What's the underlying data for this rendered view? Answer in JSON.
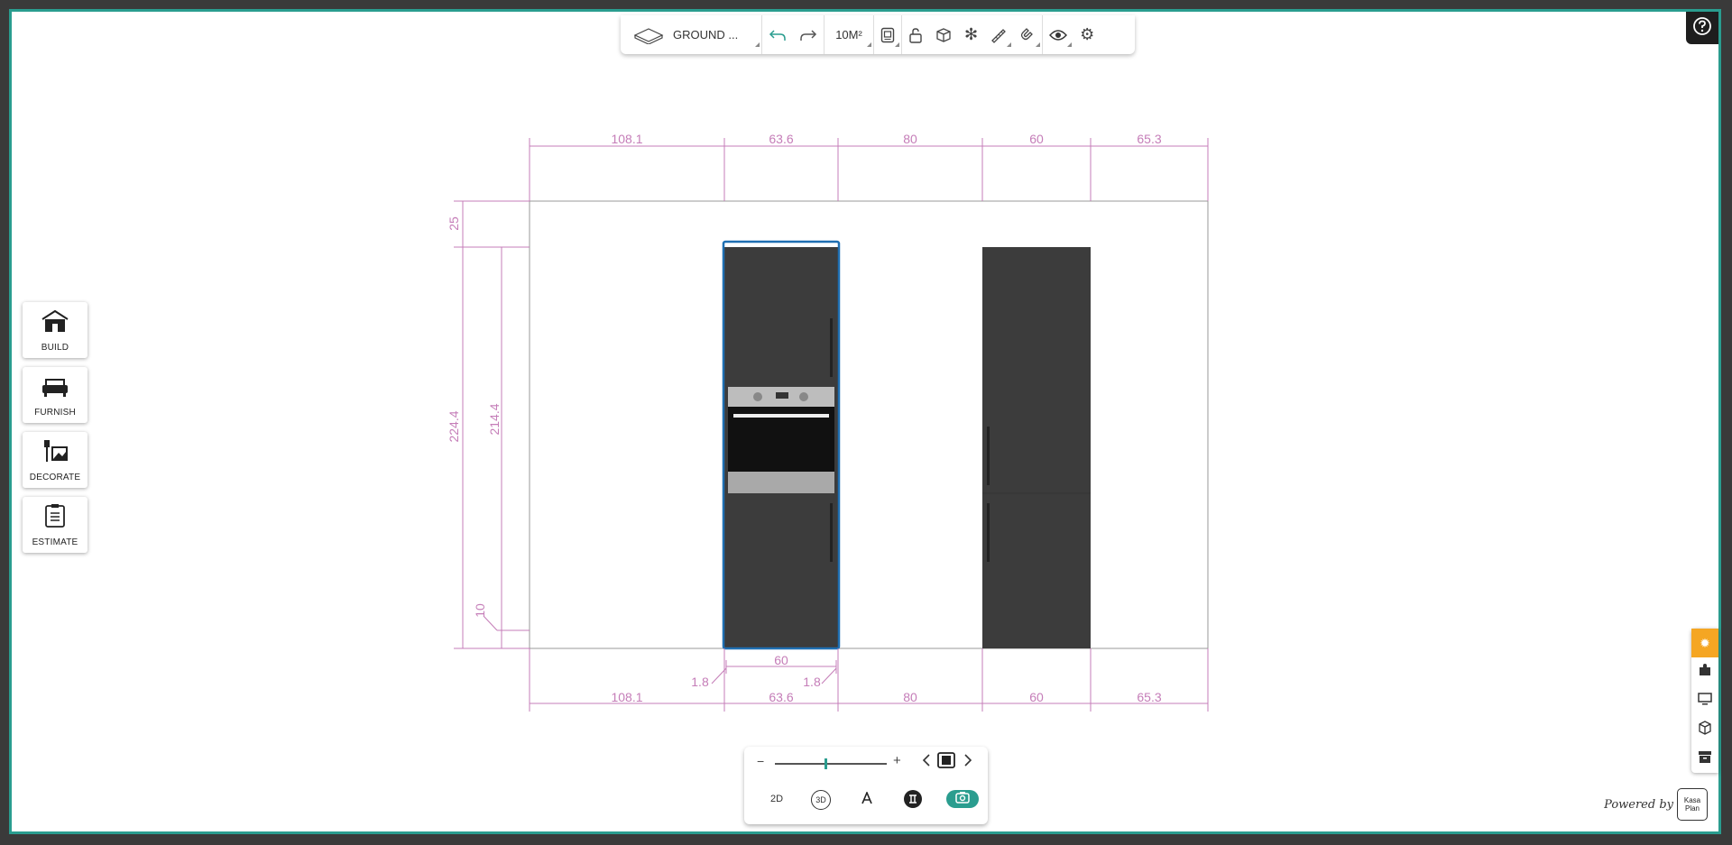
{
  "toolbar": {
    "floor_label": "GROUND ...",
    "area_label": "10M²"
  },
  "left_menu": [
    {
      "label": "BUILD",
      "icon": "house-icon"
    },
    {
      "label": "FURNISH",
      "icon": "sofa-icon"
    },
    {
      "label": "DECORATE",
      "icon": "paint-icon"
    },
    {
      "label": "ESTIMATE",
      "icon": "clipboard-icon"
    }
  ],
  "bottom": {
    "zoom_minus": "−",
    "zoom_plus": "+",
    "zoom_level": 0.45,
    "view_2d": "2D",
    "view_3d": "3D"
  },
  "dimensions": {
    "top_segments": [
      "108.1",
      "63.6",
      "80",
      "60",
      "65.3"
    ],
    "bottom_segments": [
      "108.1",
      "63.6",
      "80",
      "60",
      "65.3"
    ],
    "left_outer_top": "25",
    "left_outer_total": "224.4",
    "left_inner": "214.4",
    "left_base": "10",
    "unit_width": "60",
    "side_left": "1.8",
    "side_right": "1.8"
  },
  "powered_by": "Powered by",
  "logo_text": [
    "Kasa",
    "Plan"
  ],
  "colors": {
    "accent": "#2a9d8f",
    "dimension": "#c57db8",
    "cabinet": "#3c3c3c",
    "selection": "#1f6fb2",
    "active_tool": "#f5a623"
  }
}
